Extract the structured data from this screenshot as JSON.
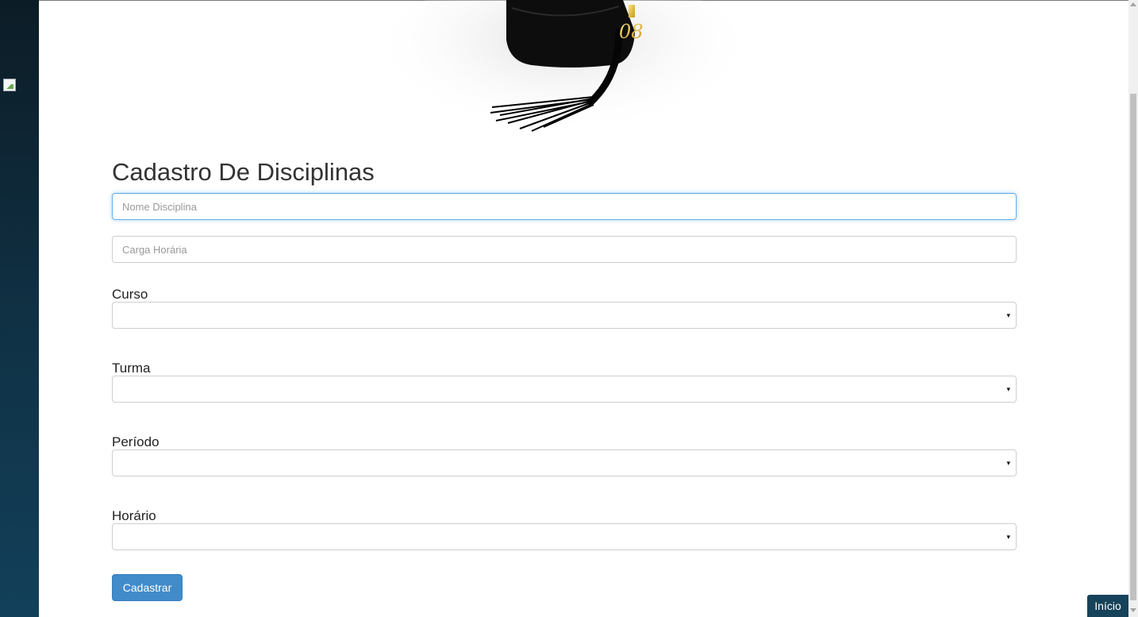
{
  "form": {
    "title": "Cadastro De Disciplinas",
    "nome_placeholder": "Nome Disciplina",
    "carga_placeholder": "Carga Horária",
    "curso_label": "Curso",
    "turma_label": "Turma",
    "periodo_label": "Período",
    "horario_label": "Horário",
    "curso_value": "",
    "turma_value": "",
    "periodo_value": "",
    "horario_value": "",
    "submit_label": "Cadastrar"
  },
  "nav": {
    "home_label": "Início"
  },
  "icons": {
    "select_arrow": "▾",
    "banner": "graduation-cap-icon",
    "sidebar_image": "broken-image-icon"
  },
  "colors": {
    "primary_button": "#428bca",
    "sidebar_top": "#0c1c26",
    "sidebar_bottom": "#12405a",
    "focus_border": "#66afe9",
    "home_button": "#16435a"
  }
}
